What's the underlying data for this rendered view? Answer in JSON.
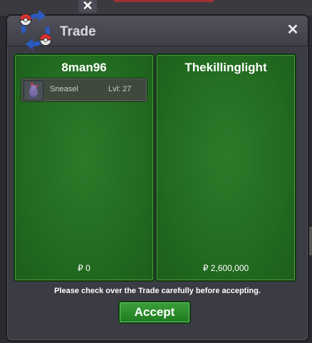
{
  "background": {
    "top_close_label": "✕"
  },
  "window": {
    "title": "Trade",
    "close_label": "✕",
    "icon": "trade-swap-icon"
  },
  "left_panel": {
    "player": "8man96",
    "items": [
      {
        "name": "Sneasel",
        "level": "Lvl: 27",
        "icon": "pokemon-sprite-icon"
      }
    ],
    "money": "₽ 0"
  },
  "right_panel": {
    "player": "Thekillinglight",
    "items": [],
    "money": "₽ 2,600,000"
  },
  "notice": "Please check over the Trade carefully before accepting.",
  "accept_label": "Accept",
  "colors": {
    "panel_green": "#226b20",
    "window_bg": "#3b3b44",
    "accept_green": "#2a8c2a"
  }
}
